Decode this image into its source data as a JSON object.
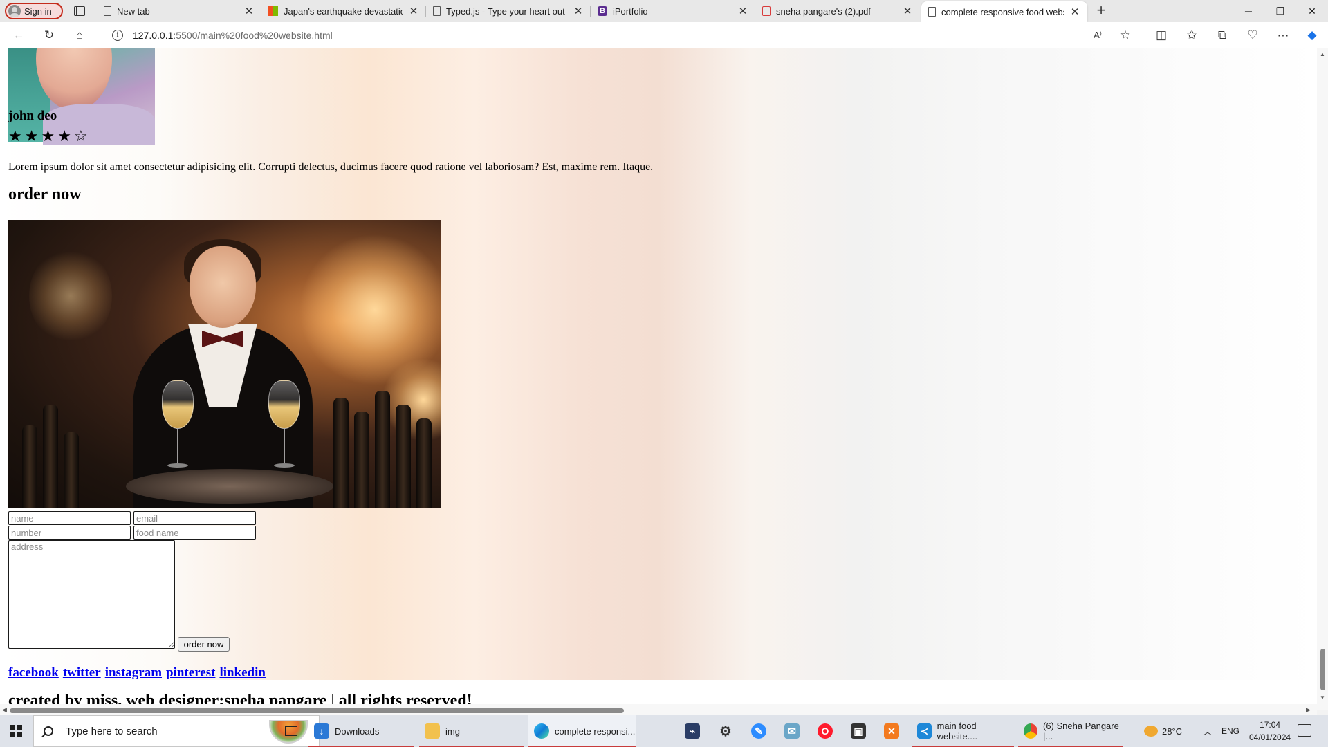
{
  "browser": {
    "signin_label": "Sign in",
    "tabs": [
      {
        "title": "New tab",
        "favicon": "page-icon"
      },
      {
        "title": "Japan's earthquake devastation c",
        "favicon": "grid-icon"
      },
      {
        "title": "Typed.js - Type your heart out",
        "favicon": "page-icon"
      },
      {
        "title": "iPortfolio",
        "favicon": "b-icon"
      },
      {
        "title": "sneha pangare's (2).pdf",
        "favicon": "pdf-icon"
      },
      {
        "title": "complete responsive food websi",
        "favicon": "page-icon",
        "active": true
      }
    ],
    "url_host": "127.0.0.1",
    "url_path": ":5500/main%20food%20website.html"
  },
  "page": {
    "reviewer_name": "john deo",
    "rating": 4,
    "rating_max": 5,
    "review_text": "Lorem ipsum dolor sit amet consectetur adipisicing elit. Corrupti delectus, ducimus facere quod ratione vel laboriosam? Est, maxime rem. Itaque.",
    "order_heading": "order now",
    "form": {
      "name_placeholder": "name",
      "email_placeholder": "email",
      "number_placeholder": "number",
      "food_placeholder": "food name",
      "address_placeholder": "address",
      "submit_label": "order now"
    },
    "social_links": [
      "facebook",
      "twitter",
      "instagram",
      "pinterest",
      "linkedin"
    ],
    "credit_text": "created by miss. web designer:sneha pangare | all rights reserved!"
  },
  "taskbar": {
    "search_placeholder": "Type here to search",
    "items": [
      {
        "label": "Downloads",
        "icon": "download-folder-icon"
      },
      {
        "label": "img",
        "icon": "folder-icon"
      },
      {
        "label": "complete responsi...",
        "icon": "edge-icon"
      },
      {
        "label": "main food website....",
        "icon": "vscode-icon"
      },
      {
        "label": "(6) Sneha Pangare |...",
        "icon": "chrome-icon"
      }
    ],
    "temperature": "28°C",
    "language": "ENG",
    "time": "17:04",
    "date": "04/01/2024"
  }
}
